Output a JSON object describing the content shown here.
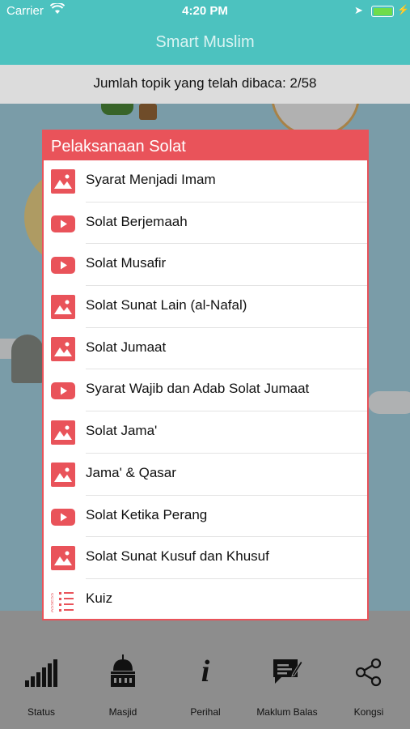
{
  "status_bar": {
    "carrier": "Carrier",
    "time": "4:20 PM"
  },
  "nav": {
    "title": "Smart Muslim"
  },
  "progress": {
    "text": "Jumlah topik yang telah dibaca: 2/58"
  },
  "dialog": {
    "title": "Pelaksanaan Solat",
    "accent_color": "#e9535a",
    "items": [
      {
        "label": "Syarat Menjadi Imam",
        "icon": "image-icon"
      },
      {
        "label": "Solat Berjemaah",
        "icon": "video-icon"
      },
      {
        "label": "Solat Musafir",
        "icon": "video-icon"
      },
      {
        "label": "Solat Sunat Lain (al-Nafal)",
        "icon": "image-icon"
      },
      {
        "label": "Solat Jumaat",
        "icon": "image-icon"
      },
      {
        "label": "Syarat Wajib dan Adab Solat Jumaat",
        "icon": "video-icon"
      },
      {
        "label": "Solat Jama'",
        "icon": "image-icon"
      },
      {
        "label": "Jama' & Qasar",
        "icon": "image-icon"
      },
      {
        "label": "Solat Ketika Perang",
        "icon": "video-icon"
      },
      {
        "label": "Solat Sunat Kusuf dan Khusuf",
        "icon": "image-icon"
      },
      {
        "label": "Kuiz",
        "icon": "quiz-icon"
      }
    ]
  },
  "tabs": [
    {
      "label": "Status",
      "icon": "signal-bars-icon"
    },
    {
      "label": "Masjid",
      "icon": "mosque-icon"
    },
    {
      "label": "Perihal",
      "icon": "info-icon"
    },
    {
      "label": "Maklum Balas",
      "icon": "feedback-icon"
    },
    {
      "label": "Kongsi",
      "icon": "share-icon"
    }
  ]
}
